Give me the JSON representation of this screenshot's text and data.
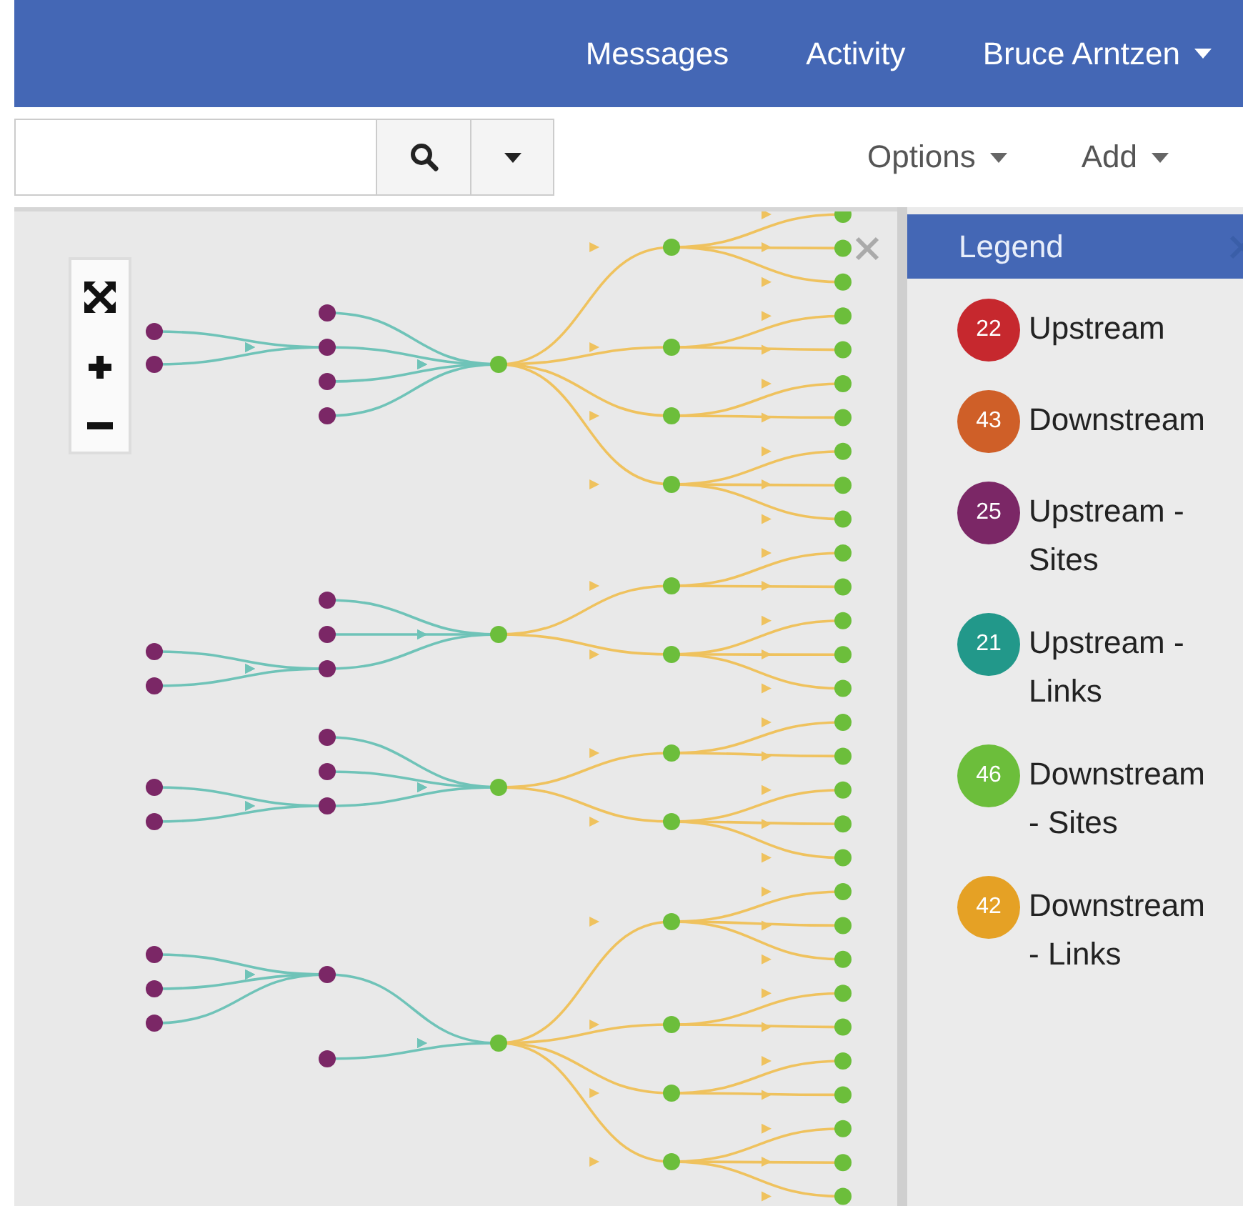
{
  "top_nav": {
    "links": [
      "Messages",
      "Activity"
    ],
    "user": "Bruce Arntzen"
  },
  "menus": [
    "Options",
    "Add"
  ],
  "legend": {
    "title": "Legend",
    "items": [
      {
        "count": "22",
        "label": "Upstream",
        "color": "#c6282e"
      },
      {
        "count": "43",
        "label": "Downstream",
        "color": "#cf5f28"
      },
      {
        "count": "25",
        "label": "Upstream - Sites",
        "color": "#7b2766"
      },
      {
        "count": "21",
        "label": "Upstream - Links",
        "color": "#22988a"
      },
      {
        "count": "46",
        "label": "Downstream - Sites",
        "color": "#6cbe3b"
      },
      {
        "count": "42",
        "label": "Downstream - Links",
        "color": "#e5a125"
      }
    ]
  }
}
